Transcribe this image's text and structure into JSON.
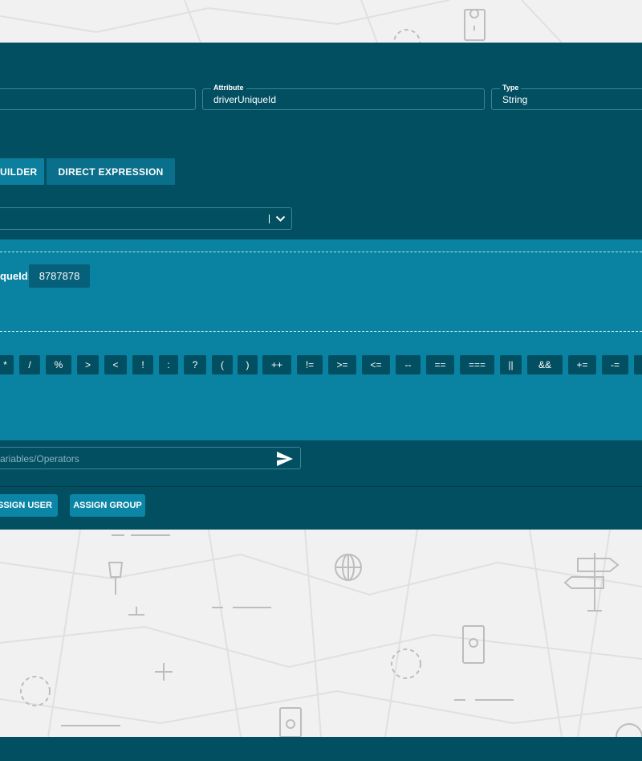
{
  "fields": {
    "attribute": {
      "label": "Attribute",
      "value": "driverUniqueId"
    },
    "type": {
      "label": "Type",
      "value": "String"
    }
  },
  "tabs": {
    "builder": "UILDER",
    "direct": "DIRECT EXPRESSION"
  },
  "condition": {
    "label": "queId:",
    "value": "8787878"
  },
  "operators": [
    "*",
    "/",
    "%",
    ">",
    "<",
    "!",
    ":",
    "?",
    "(",
    ")",
    "++",
    "!=",
    ">=",
    "<=",
    "--",
    "==",
    "===",
    "||",
    "&&",
    "+=",
    "-="
  ],
  "expression": {
    "placeholder": "ariables/Operators"
  },
  "actions": {
    "assign_user": "ASSIGN USER",
    "assign_group": "ASSIGN GROUP"
  },
  "icons": {
    "dropdown": "chevron-down-icon",
    "send": "send-icon"
  },
  "colors": {
    "dialog": "#034f62",
    "panel": "#0a83a2",
    "accent": "#0c86a6"
  }
}
